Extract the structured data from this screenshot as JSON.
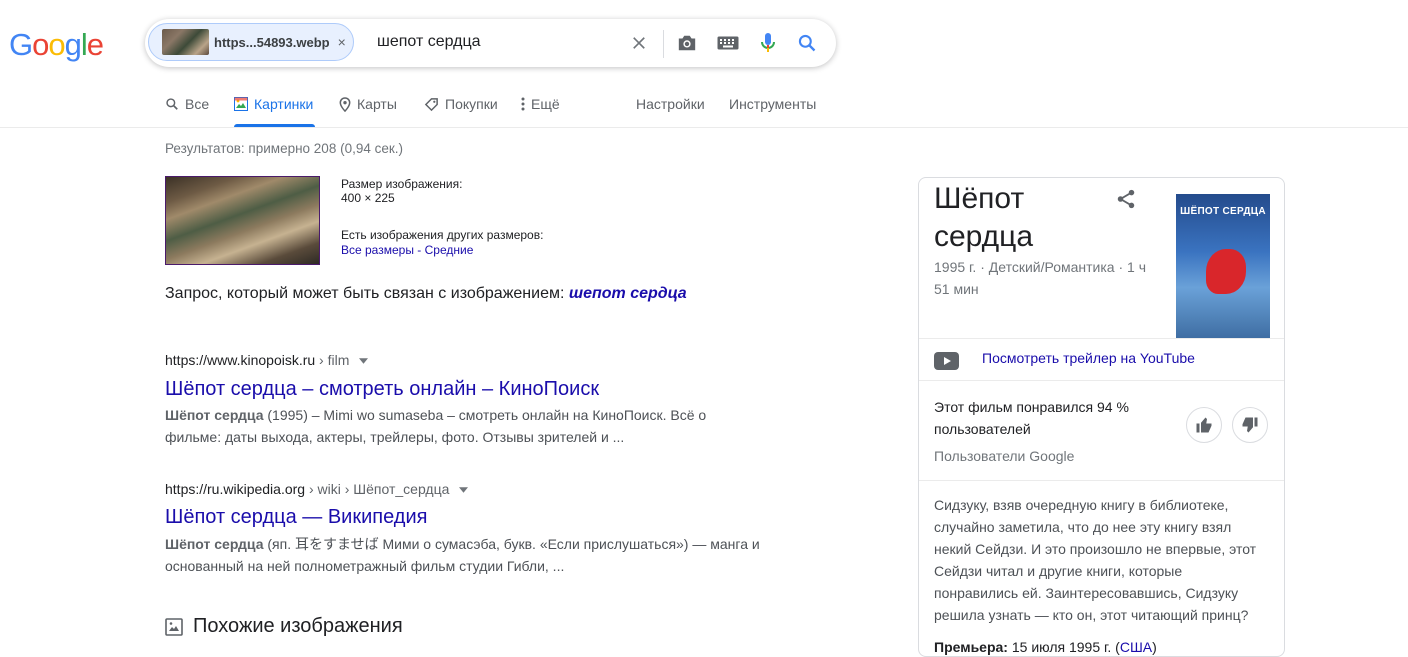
{
  "logo": {
    "letters": [
      "G",
      "o",
      "o",
      "g",
      "l",
      "e"
    ],
    "colors": [
      "#4285f4",
      "#ea4335",
      "#fbbc05",
      "#4285f4",
      "#34a853",
      "#ea4335"
    ]
  },
  "search": {
    "chip_text": "https...54893.webp",
    "chip_close": "×",
    "query": "шепот сердца"
  },
  "tabs": [
    {
      "label": "Все"
    },
    {
      "label": "Картинки"
    },
    {
      "label": "Карты"
    },
    {
      "label": "Покупки"
    },
    {
      "label": "Ещё"
    },
    {
      "label": "Настройки"
    },
    {
      "label": "Инструменты"
    }
  ],
  "stats": "Результатов: примерно 208 (0,94 сек.)",
  "image_info": {
    "size_label": "Размер изображения:",
    "size_value": "400 × 225",
    "other_sizes_label": "Есть изображения других размеров:",
    "all_sizes": "Все размеры",
    "dash": " - ",
    "medium": "Средние"
  },
  "related": {
    "prefix": "Запрос, который может быть связан с изображением:",
    "query": "шепот сердца"
  },
  "results": [
    {
      "cite_domain": "https://www.kinopoisk.ru",
      "cite_path": " › film",
      "title": "Шёпот сердца – смотреть онлайн – КиноПоиск",
      "snippet_bold": "Шёпот сердца",
      "snippet_line1": " (1995) – Mimi wo sumaseba – смотреть онлайн на КиноПоиск. Всё о",
      "snippet_line2": "фильме: даты выхода, актеры, трейлеры, фото. Отзывы зрителей и ..."
    },
    {
      "cite_domain": "https://ru.wikipedia.org",
      "cite_path": " › wiki › Шёпот_сердца",
      "title": "Шёпот сердца — Википедия",
      "snippet_bold": "Шёпот сердца",
      "snippet_line1": " (яп. 耳をすませば Мими о сумасэба, букв. «Если прислушаться») — манга и",
      "snippet_line2": "основанный на ней полнометражный фильм студии Гибли, ..."
    }
  ],
  "similar_title": "Похожие изображения",
  "knowledge_panel": {
    "title": "Шёпот сердца",
    "subtitle": "1995 г. · Детский/Романтика · 1 ч 51 мин",
    "poster_text": "ШЁПОТ СЕРДЦА",
    "trailer_link": "Посмотреть трейлер на YouTube",
    "liked_text": "Этот фильм понравился 94 % пользователей",
    "liked_by": "Пользователи Google",
    "description": "Сидзуку, взяв очередную книгу в библиотеке, случайно заметила, что до нее эту книгу взял некий Сейдзи. И это произошло не впервые, этот Сейдзи читал и другие книги, которые понравились ей. Заинтересовавшись, Сидзуку решила узнать — кто он, этот читающий принц?",
    "premiere_label": "Премьера:",
    "premiere_value": " 15 июля 1995 г. (",
    "premiere_country": "США",
    "premiere_close": ")"
  }
}
